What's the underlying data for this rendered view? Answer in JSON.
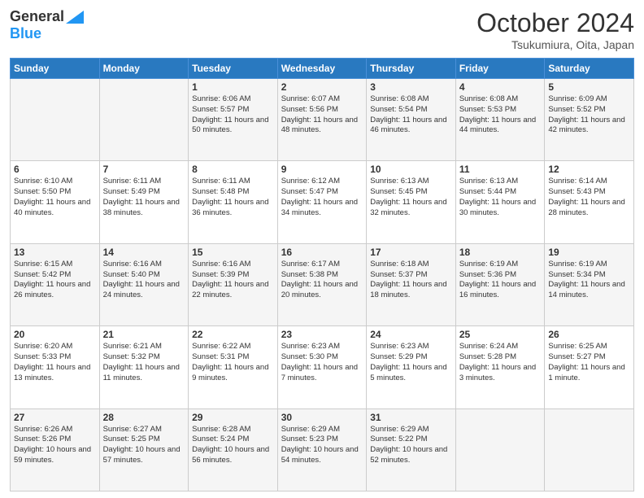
{
  "header": {
    "logo": {
      "line1": "General",
      "line2": "Blue"
    },
    "title": "October 2024",
    "location": "Tsukumiura, Oita, Japan"
  },
  "days_of_week": [
    "Sunday",
    "Monday",
    "Tuesday",
    "Wednesday",
    "Thursday",
    "Friday",
    "Saturday"
  ],
  "weeks": [
    [
      {
        "day": "",
        "sunrise": "",
        "sunset": "",
        "daylight": ""
      },
      {
        "day": "",
        "sunrise": "",
        "sunset": "",
        "daylight": ""
      },
      {
        "day": "1",
        "sunrise": "Sunrise: 6:06 AM",
        "sunset": "Sunset: 5:57 PM",
        "daylight": "Daylight: 11 hours and 50 minutes."
      },
      {
        "day": "2",
        "sunrise": "Sunrise: 6:07 AM",
        "sunset": "Sunset: 5:56 PM",
        "daylight": "Daylight: 11 hours and 48 minutes."
      },
      {
        "day": "3",
        "sunrise": "Sunrise: 6:08 AM",
        "sunset": "Sunset: 5:54 PM",
        "daylight": "Daylight: 11 hours and 46 minutes."
      },
      {
        "day": "4",
        "sunrise": "Sunrise: 6:08 AM",
        "sunset": "Sunset: 5:53 PM",
        "daylight": "Daylight: 11 hours and 44 minutes."
      },
      {
        "day": "5",
        "sunrise": "Sunrise: 6:09 AM",
        "sunset": "Sunset: 5:52 PM",
        "daylight": "Daylight: 11 hours and 42 minutes."
      }
    ],
    [
      {
        "day": "6",
        "sunrise": "Sunrise: 6:10 AM",
        "sunset": "Sunset: 5:50 PM",
        "daylight": "Daylight: 11 hours and 40 minutes."
      },
      {
        "day": "7",
        "sunrise": "Sunrise: 6:11 AM",
        "sunset": "Sunset: 5:49 PM",
        "daylight": "Daylight: 11 hours and 38 minutes."
      },
      {
        "day": "8",
        "sunrise": "Sunrise: 6:11 AM",
        "sunset": "Sunset: 5:48 PM",
        "daylight": "Daylight: 11 hours and 36 minutes."
      },
      {
        "day": "9",
        "sunrise": "Sunrise: 6:12 AM",
        "sunset": "Sunset: 5:47 PM",
        "daylight": "Daylight: 11 hours and 34 minutes."
      },
      {
        "day": "10",
        "sunrise": "Sunrise: 6:13 AM",
        "sunset": "Sunset: 5:45 PM",
        "daylight": "Daylight: 11 hours and 32 minutes."
      },
      {
        "day": "11",
        "sunrise": "Sunrise: 6:13 AM",
        "sunset": "Sunset: 5:44 PM",
        "daylight": "Daylight: 11 hours and 30 minutes."
      },
      {
        "day": "12",
        "sunrise": "Sunrise: 6:14 AM",
        "sunset": "Sunset: 5:43 PM",
        "daylight": "Daylight: 11 hours and 28 minutes."
      }
    ],
    [
      {
        "day": "13",
        "sunrise": "Sunrise: 6:15 AM",
        "sunset": "Sunset: 5:42 PM",
        "daylight": "Daylight: 11 hours and 26 minutes."
      },
      {
        "day": "14",
        "sunrise": "Sunrise: 6:16 AM",
        "sunset": "Sunset: 5:40 PM",
        "daylight": "Daylight: 11 hours and 24 minutes."
      },
      {
        "day": "15",
        "sunrise": "Sunrise: 6:16 AM",
        "sunset": "Sunset: 5:39 PM",
        "daylight": "Daylight: 11 hours and 22 minutes."
      },
      {
        "day": "16",
        "sunrise": "Sunrise: 6:17 AM",
        "sunset": "Sunset: 5:38 PM",
        "daylight": "Daylight: 11 hours and 20 minutes."
      },
      {
        "day": "17",
        "sunrise": "Sunrise: 6:18 AM",
        "sunset": "Sunset: 5:37 PM",
        "daylight": "Daylight: 11 hours and 18 minutes."
      },
      {
        "day": "18",
        "sunrise": "Sunrise: 6:19 AM",
        "sunset": "Sunset: 5:36 PM",
        "daylight": "Daylight: 11 hours and 16 minutes."
      },
      {
        "day": "19",
        "sunrise": "Sunrise: 6:19 AM",
        "sunset": "Sunset: 5:34 PM",
        "daylight": "Daylight: 11 hours and 14 minutes."
      }
    ],
    [
      {
        "day": "20",
        "sunrise": "Sunrise: 6:20 AM",
        "sunset": "Sunset: 5:33 PM",
        "daylight": "Daylight: 11 hours and 13 minutes."
      },
      {
        "day": "21",
        "sunrise": "Sunrise: 6:21 AM",
        "sunset": "Sunset: 5:32 PM",
        "daylight": "Daylight: 11 hours and 11 minutes."
      },
      {
        "day": "22",
        "sunrise": "Sunrise: 6:22 AM",
        "sunset": "Sunset: 5:31 PM",
        "daylight": "Daylight: 11 hours and 9 minutes."
      },
      {
        "day": "23",
        "sunrise": "Sunrise: 6:23 AM",
        "sunset": "Sunset: 5:30 PM",
        "daylight": "Daylight: 11 hours and 7 minutes."
      },
      {
        "day": "24",
        "sunrise": "Sunrise: 6:23 AM",
        "sunset": "Sunset: 5:29 PM",
        "daylight": "Daylight: 11 hours and 5 minutes."
      },
      {
        "day": "25",
        "sunrise": "Sunrise: 6:24 AM",
        "sunset": "Sunset: 5:28 PM",
        "daylight": "Daylight: 11 hours and 3 minutes."
      },
      {
        "day": "26",
        "sunrise": "Sunrise: 6:25 AM",
        "sunset": "Sunset: 5:27 PM",
        "daylight": "Daylight: 11 hours and 1 minute."
      }
    ],
    [
      {
        "day": "27",
        "sunrise": "Sunrise: 6:26 AM",
        "sunset": "Sunset: 5:26 PM",
        "daylight": "Daylight: 10 hours and 59 minutes."
      },
      {
        "day": "28",
        "sunrise": "Sunrise: 6:27 AM",
        "sunset": "Sunset: 5:25 PM",
        "daylight": "Daylight: 10 hours and 57 minutes."
      },
      {
        "day": "29",
        "sunrise": "Sunrise: 6:28 AM",
        "sunset": "Sunset: 5:24 PM",
        "daylight": "Daylight: 10 hours and 56 minutes."
      },
      {
        "day": "30",
        "sunrise": "Sunrise: 6:29 AM",
        "sunset": "Sunset: 5:23 PM",
        "daylight": "Daylight: 10 hours and 54 minutes."
      },
      {
        "day": "31",
        "sunrise": "Sunrise: 6:29 AM",
        "sunset": "Sunset: 5:22 PM",
        "daylight": "Daylight: 10 hours and 52 minutes."
      },
      {
        "day": "",
        "sunrise": "",
        "sunset": "",
        "daylight": ""
      },
      {
        "day": "",
        "sunrise": "",
        "sunset": "",
        "daylight": ""
      }
    ]
  ]
}
